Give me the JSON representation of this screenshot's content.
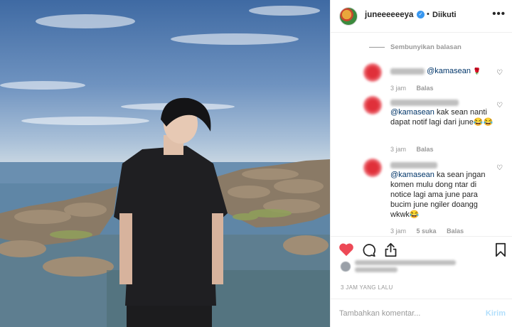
{
  "post": {
    "image_alt": ""
  },
  "header": {
    "username": "juneeeeeeya",
    "verified_glyph": "✓",
    "separator": "•",
    "follow_status": "Diikuti",
    "more_glyph": "•••"
  },
  "comments": {
    "hide_replies": "Sembunyikan balasan",
    "items": [
      {
        "mention": "@kamasean",
        "text_after": "",
        "emoji": "🌹",
        "time": "3 jam",
        "likes": "",
        "reply": "Balas"
      },
      {
        "mention": "@kamasean",
        "text_after": " kak sean nanti dapat notif lagi dari june😂😂",
        "emoji": "",
        "time": "3 jam",
        "likes": "",
        "reply": "Balas"
      },
      {
        "mention": "@kamasean",
        "text_after": " ka sean jngan komen mulu dong ntar di notice lagi ama june para bucim june ngiler doangg wkwk😂",
        "emoji": "",
        "time": "3 jam",
        "likes": "5 suka",
        "reply": "Balas"
      }
    ]
  },
  "actions": {
    "like_icon": "heart-icon",
    "comment_icon": "comment-icon",
    "share_icon": "share-icon",
    "save_icon": "bookmark-icon",
    "like_color": "#ed4956"
  },
  "post_time": "3 JAM YANG LALU",
  "comment_box": {
    "placeholder": "Tambahkan komentar...",
    "send_label": "Kirim",
    "send_color": "#b2dffc"
  }
}
